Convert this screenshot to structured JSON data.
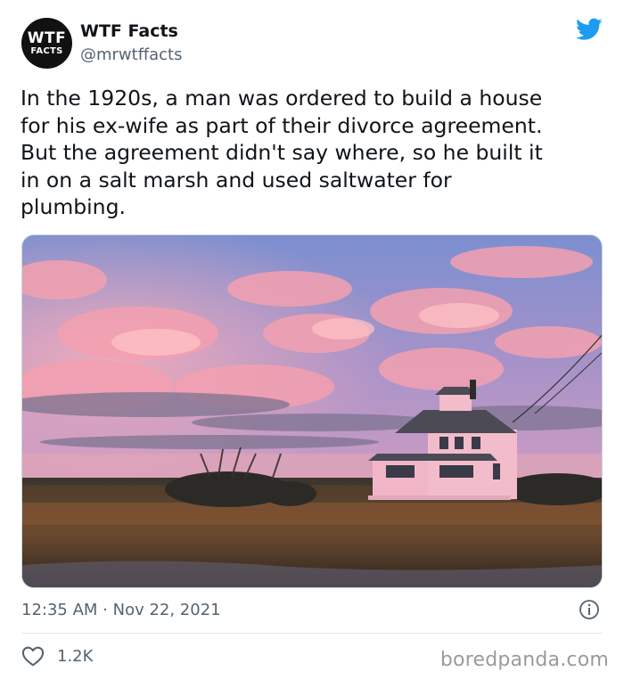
{
  "account": {
    "avatar_line1": "WTF",
    "avatar_line2": "FACTS",
    "name": "WTF Facts",
    "handle": "@mrwtffacts"
  },
  "tweet": {
    "text": "In the 1920s, a man was ordered to build a house\nfor his ex-wife as part of their divorce agreement.\nBut the agreement didn't say where, so he built it\nin on a salt marsh and used saltwater for\nplumbing.",
    "timestamp": "12:35 AM · Nov 22, 2021",
    "like_count": "1.2K"
  },
  "icons": {
    "brand": "twitter-bird-icon",
    "info": "info-icon",
    "like": "heart-icon"
  },
  "colors": {
    "twitter_blue": "#1d9bf0",
    "secondary_text": "#536471"
  },
  "watermark": "boredpanda.com"
}
